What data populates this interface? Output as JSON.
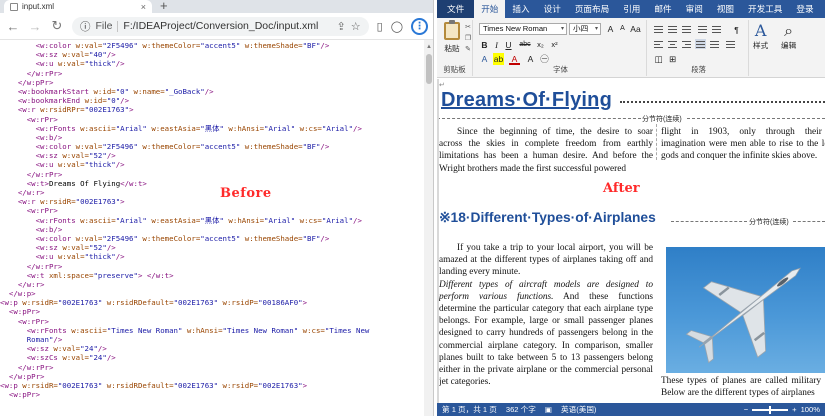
{
  "browser": {
    "tab_title": "input.xml",
    "tab_close": "×",
    "new_tab": "+",
    "address_label": "File",
    "address_url": "F:/IDEAProject/Conversion_Doc/input.xml"
  },
  "xml_lines": [
    [
      [
        "        ",
        ""
      ],
      [
        "<w:color ",
        "tg"
      ],
      [
        "w:val=",
        "an"
      ],
      [
        "\"2F5496\"",
        "av"
      ],
      [
        " w:themeColor=",
        "an"
      ],
      [
        "\"accent5\"",
        "av"
      ],
      [
        " w:themeShade=",
        "an"
      ],
      [
        "\"BF\"",
        "av"
      ],
      [
        "/>",
        "tg"
      ]
    ],
    [
      [
        "        ",
        ""
      ],
      [
        "<w:sz ",
        "tg"
      ],
      [
        "w:val=",
        "an"
      ],
      [
        "\"40\"",
        "av"
      ],
      [
        "/>",
        "tg"
      ]
    ],
    [
      [
        "        ",
        ""
      ],
      [
        "<w:u ",
        "tg"
      ],
      [
        "w:val=",
        "an"
      ],
      [
        "\"thick\"",
        "av"
      ],
      [
        "/>",
        "tg"
      ]
    ],
    [
      [
        "      ",
        ""
      ],
      [
        "</w:rPr>",
        "tg"
      ]
    ],
    [
      [
        "    ",
        ""
      ],
      [
        "</w:pPr>",
        "tg"
      ]
    ],
    [
      [
        "    ",
        ""
      ],
      [
        "<w:bookmarkStart ",
        "tg"
      ],
      [
        "w:id=",
        "an"
      ],
      [
        "\"0\"",
        "av"
      ],
      [
        " w:name=",
        "an"
      ],
      [
        "\"_GoBack\"",
        "av"
      ],
      [
        "/>",
        "tg"
      ]
    ],
    [
      [
        "    ",
        ""
      ],
      [
        "<w:bookmarkEnd ",
        "tg"
      ],
      [
        "w:id=",
        "an"
      ],
      [
        "\"0\"",
        "av"
      ],
      [
        "/>",
        "tg"
      ]
    ],
    [
      [
        "    ",
        ""
      ],
      [
        "<w:r ",
        "tg"
      ],
      [
        "w:rsidRPr=",
        "an"
      ],
      [
        "\"002E1763\"",
        "av"
      ],
      [
        ">",
        "tg"
      ]
    ],
    [
      [
        "      ",
        ""
      ],
      [
        "<w:rPr>",
        "tg"
      ]
    ],
    [
      [
        "        ",
        ""
      ],
      [
        "<w:rFonts ",
        "tg"
      ],
      [
        "w:ascii=",
        "an"
      ],
      [
        "\"Arial\"",
        "av"
      ],
      [
        " w:eastAsia=",
        "an"
      ],
      [
        "\"黑体\"",
        "av"
      ],
      [
        " w:hAnsi=",
        "an"
      ],
      [
        "\"Arial\"",
        "av"
      ],
      [
        " w:cs=",
        "an"
      ],
      [
        "\"Arial\"",
        "av"
      ],
      [
        "/>",
        "tg"
      ]
    ],
    [
      [
        "        ",
        ""
      ],
      [
        "<w:b/>",
        "tg"
      ]
    ],
    [
      [
        "        ",
        ""
      ],
      [
        "<w:color ",
        "tg"
      ],
      [
        "w:val=",
        "an"
      ],
      [
        "\"2F5496\"",
        "av"
      ],
      [
        " w:themeColor=",
        "an"
      ],
      [
        "\"accent5\"",
        "av"
      ],
      [
        " w:themeShade=",
        "an"
      ],
      [
        "\"BF\"",
        "av"
      ],
      [
        "/>",
        "tg"
      ]
    ],
    [
      [
        "        ",
        ""
      ],
      [
        "<w:sz ",
        "tg"
      ],
      [
        "w:val=",
        "an"
      ],
      [
        "\"52\"",
        "av"
      ],
      [
        "/>",
        "tg"
      ]
    ],
    [
      [
        "        ",
        ""
      ],
      [
        "<w:u ",
        "tg"
      ],
      [
        "w:val=",
        "an"
      ],
      [
        "\"thick\"",
        "av"
      ],
      [
        "/>",
        "tg"
      ]
    ],
    [
      [
        "      ",
        ""
      ],
      [
        "</w:rPr>",
        "tg"
      ]
    ],
    [
      [
        "      ",
        ""
      ],
      [
        "<w:t>",
        "tg"
      ],
      [
        "Dreams Of Flying",
        "tx"
      ],
      [
        "</w:t>",
        "tg"
      ]
    ],
    [
      [
        "    ",
        ""
      ],
      [
        "</w:r>",
        "tg"
      ]
    ],
    [
      [
        "    ",
        ""
      ],
      [
        "<w:r ",
        "tg"
      ],
      [
        "w:rsidR=",
        "an"
      ],
      [
        "\"002E1763\"",
        "av"
      ],
      [
        ">",
        "tg"
      ]
    ],
    [
      [
        "      ",
        ""
      ],
      [
        "<w:rPr>",
        "tg"
      ]
    ],
    [
      [
        "        ",
        ""
      ],
      [
        "<w:rFonts ",
        "tg"
      ],
      [
        "w:ascii=",
        "an"
      ],
      [
        "\"Arial\"",
        "av"
      ],
      [
        " w:eastAsia=",
        "an"
      ],
      [
        "\"黑体\"",
        "av"
      ],
      [
        " w:hAnsi=",
        "an"
      ],
      [
        "\"Arial\"",
        "av"
      ],
      [
        " w:cs=",
        "an"
      ],
      [
        "\"Arial\"",
        "av"
      ],
      [
        "/>",
        "tg"
      ]
    ],
    [
      [
        "        ",
        ""
      ],
      [
        "<w:b/>",
        "tg"
      ]
    ],
    [
      [
        "        ",
        ""
      ],
      [
        "<w:color ",
        "tg"
      ],
      [
        "w:val=",
        "an"
      ],
      [
        "\"2F5496\"",
        "av"
      ],
      [
        " w:themeColor=",
        "an"
      ],
      [
        "\"accent5\"",
        "av"
      ],
      [
        " w:themeShade=",
        "an"
      ],
      [
        "\"BF\"",
        "av"
      ],
      [
        "/>",
        "tg"
      ]
    ],
    [
      [
        "        ",
        ""
      ],
      [
        "<w:sz ",
        "tg"
      ],
      [
        "w:val=",
        "an"
      ],
      [
        "\"52\"",
        "av"
      ],
      [
        "/>",
        "tg"
      ]
    ],
    [
      [
        "        ",
        ""
      ],
      [
        "<w:u ",
        "tg"
      ],
      [
        "w:val=",
        "an"
      ],
      [
        "\"thick\"",
        "av"
      ],
      [
        "/>",
        "tg"
      ]
    ],
    [
      [
        "      ",
        ""
      ],
      [
        "</w:rPr>",
        "tg"
      ]
    ],
    [
      [
        "      ",
        ""
      ],
      [
        "<w:t ",
        "tg"
      ],
      [
        "xml:space=",
        "an"
      ],
      [
        "\"preserve\"",
        "av"
      ],
      [
        "> ",
        "tg"
      ],
      [
        "</w:t>",
        "tg"
      ]
    ],
    [
      [
        "    ",
        ""
      ],
      [
        "</w:r>",
        "tg"
      ]
    ],
    [
      [
        "  ",
        ""
      ],
      [
        "</w:p>",
        "tg"
      ]
    ],
    [
      [
        "",
        ""
      ],
      [
        "<w:p ",
        "tg"
      ],
      [
        "w:rsidR=",
        "an"
      ],
      [
        "\"002E1763\"",
        "av"
      ],
      [
        " w:rsidRDefault=",
        "an"
      ],
      [
        "\"002E1763\"",
        "av"
      ],
      [
        " w:rsidP=",
        "an"
      ],
      [
        "\"00186AF0\"",
        "av"
      ],
      [
        ">",
        "tg"
      ]
    ],
    [
      [
        "  ",
        ""
      ],
      [
        "<w:pPr>",
        "tg"
      ]
    ],
    [
      [
        "    ",
        ""
      ],
      [
        "<w:rPr>",
        "tg"
      ]
    ],
    [
      [
        "      ",
        ""
      ],
      [
        "<w:rFonts ",
        "tg"
      ],
      [
        "w:ascii=",
        "an"
      ],
      [
        "\"Times New Roman\"",
        "av"
      ],
      [
        " w:hAnsi=",
        "an"
      ],
      [
        "\"Times New Roman\"",
        "av"
      ],
      [
        " w:cs=",
        "an"
      ],
      [
        "\"Times New",
        "av"
      ]
    ],
    [
      [
        "      ",
        ""
      ],
      [
        "Roman\"",
        "av"
      ],
      [
        "/>",
        "tg"
      ]
    ],
    [
      [
        "      ",
        ""
      ],
      [
        "<w:sz ",
        "tg"
      ],
      [
        "w:val=",
        "an"
      ],
      [
        "\"24\"",
        "av"
      ],
      [
        "/>",
        "tg"
      ]
    ],
    [
      [
        "      ",
        ""
      ],
      [
        "<w:szCs ",
        "tg"
      ],
      [
        "w:val=",
        "an"
      ],
      [
        "\"24\"",
        "av"
      ],
      [
        "/>",
        "tg"
      ]
    ],
    [
      [
        "    ",
        ""
      ],
      [
        "</w:rPr>",
        "tg"
      ]
    ],
    [
      [
        "  ",
        ""
      ],
      [
        "</w:pPr>",
        "tg"
      ]
    ],
    [
      [
        "",
        ""
      ],
      [
        "<w:p ",
        "tg"
      ],
      [
        "w:rsidR=",
        "an"
      ],
      [
        "\"002E1763\"",
        "av"
      ],
      [
        " w:rsidRDefault=",
        "an"
      ],
      [
        "\"002E1763\"",
        "av"
      ],
      [
        " w:rsidP=",
        "an"
      ],
      [
        "\"002E1763\"",
        "av"
      ],
      [
        ">",
        "tg"
      ]
    ],
    [
      [
        "  ",
        ""
      ],
      [
        "<w:pPr>",
        "tg"
      ]
    ]
  ],
  "labels": {
    "before": "Before",
    "after": "After"
  },
  "word": {
    "tabs": [
      "文件",
      "开始",
      "插入",
      "设计",
      "页面布局",
      "引用",
      "邮件",
      "审阅",
      "视图",
      "开发工具",
      "登录"
    ],
    "active_tab": "开始",
    "ribbon": {
      "paste": "粘贴",
      "clipboard": "剪贴板",
      "font_name": "Times New Roman",
      "font_size": "小四",
      "font_group": "字体",
      "para_group": "段落",
      "styles": "样式",
      "edit": "编辑",
      "bold": "B",
      "italic": "I",
      "underline": "U",
      "strike": "abc",
      "sub": "x₂",
      "sup": "x²"
    },
    "doc": {
      "title": "Dreams·Of·Flying",
      "section_break": "分节符(连续)",
      "para1_left": "Since the beginning of time, the desire to soar across the skies in complete freedom from earthly limitations has been a human desire. And before the Wright brothers made the first successful powered",
      "para1_right": "flight in 1903, only through their vivid imagination were men able to rise to the level of gods and conquer the infinite skies above.",
      "heading2": "※18·Different·Types·of·Airplanes",
      "para2": "If you take a trip to your local airport, you will be amazed at the different types of airplanes taking off and landing every minute.",
      "para3_italic": "Different types of aircraft models are designed to perform various functions.",
      "para3_rest": " And these functions determine the particular category that each airplane type belongs. For example, large or small passenger planes designed to carry hundreds of passengers belong in the commercial airplane category. In comparison, smaller planes built to take between 5 to 13 passengers belong either in the private airplane or the commercial personal jet categories.",
      "photo_caption": "These types of planes are called military planes. Below are the different types of airplanes"
    },
    "status": {
      "page": "第 1 页，共 1 页",
      "words": "362 个字",
      "lang": "英语(美国)",
      "zoom": "100%"
    }
  }
}
